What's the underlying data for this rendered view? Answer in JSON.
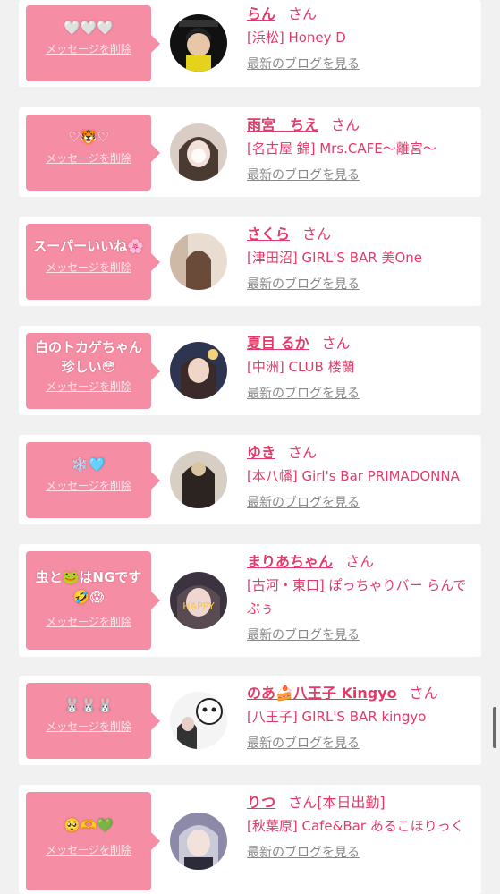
{
  "delete_label": "メッセージを削除",
  "blog_label": "最新のブログを見る",
  "san": "さん",
  "cards": [
    {
      "message": "🤍🤍🤍",
      "name": "らん",
      "extra": "",
      "shop": "[浜松] Honey D"
    },
    {
      "message": "♡🐯♡",
      "name": "雨宮　ちえ",
      "extra": "",
      "shop": "[名古屋 錦] Mrs.CAFE〜離宮〜"
    },
    {
      "message": "スーパーいいね🌸",
      "name": "さくら",
      "extra": "",
      "shop": "[津田沼] GIRL'S BAR 美One"
    },
    {
      "message": "白のトカゲちゃん\n珍しい😳",
      "name": "夏目 るか",
      "extra": "",
      "shop": "[中洲] CLUB 楼蘭"
    },
    {
      "message": "❄️🩵",
      "name": "ゆき",
      "extra": "",
      "shop": "[本八幡] Girl's Bar PRIMADONNA"
    },
    {
      "message": "虫と🐸はNGです\n🤣😱",
      "name": "まりあちゃん",
      "extra": "",
      "shop": "[古河・東口] ぽっちゃりバー らんでぶぅ"
    },
    {
      "message": "🐰🐰🐰",
      "name": "のあ🍰八王子 Kingyo",
      "extra": "",
      "shop": "[八王子] GIRL'S BAR kingyo"
    },
    {
      "message": "🥺🫶💚",
      "name": "りつ",
      "extra": "[本日出勤]",
      "shop": "[秋葉原] Cafe&Bar あるこほりっく"
    }
  ],
  "colors": {
    "accent": "#e43a6a",
    "bubble": "#f58ea4",
    "background": "#f1f1f1"
  }
}
